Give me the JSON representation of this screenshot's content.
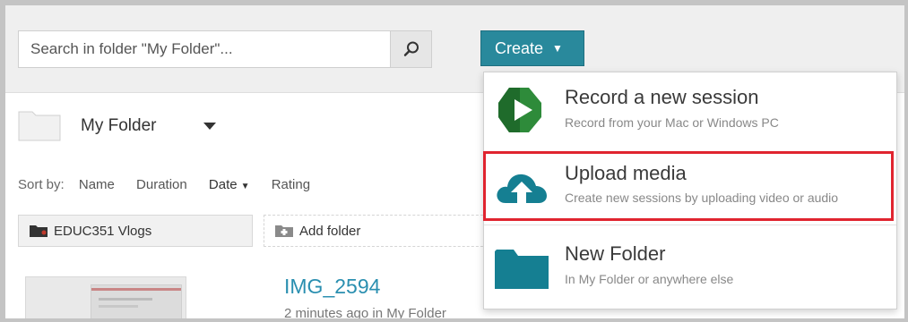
{
  "search": {
    "placeholder": "Search in folder \"My Folder\"...",
    "value": ""
  },
  "create_button": {
    "label": "Create",
    "color": "#29899c"
  },
  "folder": {
    "name": "My Folder"
  },
  "sort": {
    "label": "Sort by:",
    "options": [
      "Name",
      "Duration",
      "Date",
      "Rating"
    ],
    "active": "Date",
    "active_direction": "descending"
  },
  "folders": [
    {
      "name": "EDUC351 Vlogs"
    }
  ],
  "add_folder_label": "Add folder",
  "session": {
    "title": "IMG_2594",
    "meta": "2 minutes ago in My Folder"
  },
  "dropdown": {
    "items": [
      {
        "title": "Record a new session",
        "subtitle": "Record from your Mac or Windows PC",
        "icon": "panopto-play-icon"
      },
      {
        "title": "Upload media",
        "subtitle": "Create new sessions by uploading video or audio",
        "icon": "cloud-upload-icon",
        "highlighted": true
      },
      {
        "title": "New Folder",
        "subtitle": "In My Folder or anywhere else",
        "icon": "folder-icon"
      }
    ],
    "highlight_color": "#e0242f",
    "icon_color": "#157f92"
  }
}
